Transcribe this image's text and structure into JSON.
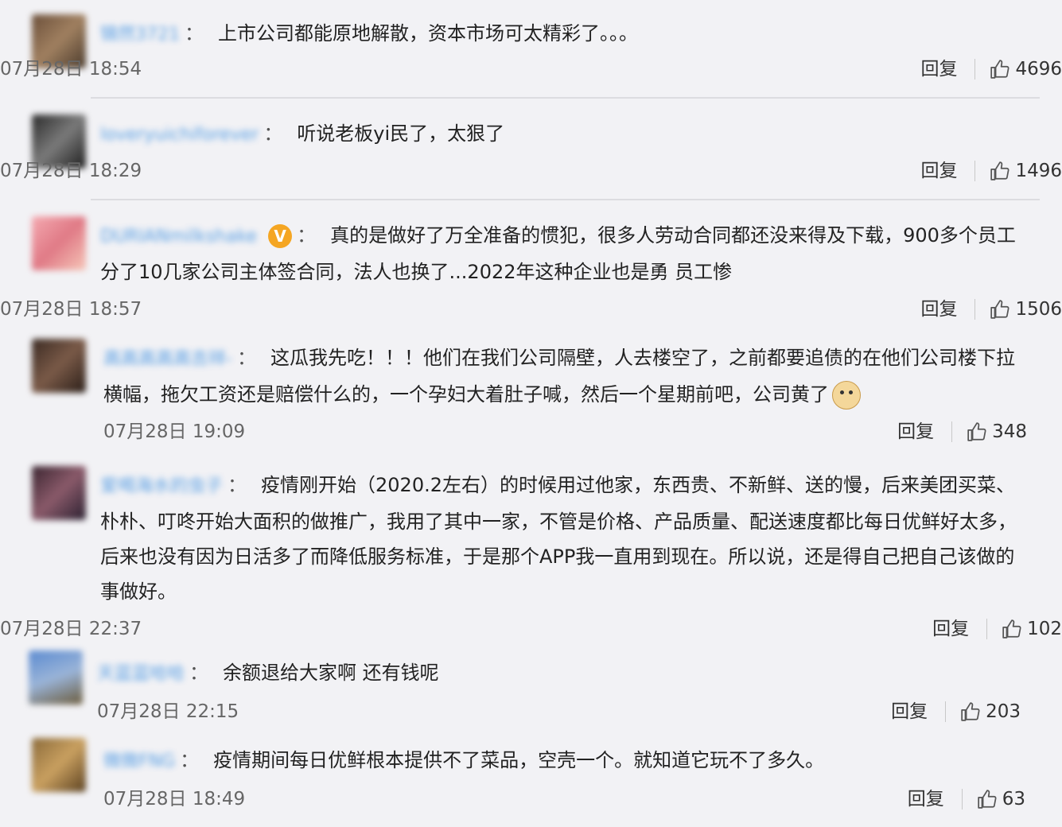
{
  "colors": {
    "panel_bg": "#f2f2f5",
    "username": "#3c8fe0",
    "time": "#666666",
    "text": "#222222",
    "badge": "#f5a623"
  },
  "comments": [
    {
      "username": "锦然3721",
      "text": "上市公司都能原地解散，资本市场可太精彩了。。。",
      "time": "07月28日 18:54",
      "reply_label": "回复",
      "likes": "4696",
      "verified": false
    },
    {
      "username": "loveryuichiforever",
      "text": "听说老板yi民了，太狠了",
      "time": "07月28日 18:29",
      "reply_label": "回复",
      "likes": "1496",
      "verified": false
    },
    {
      "username": "DURIANmilkshake",
      "text": "真的是做好了万全准备的惯犯，很多人劳动合同都还没来得及下载，900多个员工分了10几家公司主体签合同，法人也换了...2022年这种企业也是勇 员工惨",
      "time": "07月28日 18:57",
      "reply_label": "回复",
      "likes": "1506",
      "verified": true,
      "verified_glyph": "V"
    },
    {
      "username": "高高高高高吉祥-",
      "text": "这瓜我先吃！！！他们在我们公司隔壁，人去楼空了，之前都要追债的在他们公司楼下拉横幅，拖欠工资还是赔偿什么的，一个孕妇大着肚子喊，然后一个星期前吧，公司黄了",
      "time": "07月28日 19:09",
      "reply_label": "回复",
      "likes": "348",
      "verified": false,
      "emoji": "doge-emoji"
    },
    {
      "username": "爱喝海水的虫子",
      "text": "疫情刚开始（2020.2左右）的时候用过他家，东西贵、不新鲜、送的慢，后来美团买菜、朴朴、叮咚开始大面积的做推广，我用了其中一家，不管是价格、产品质量、配送速度都比每日优鲜好太多，后来也没有因为日活多了而降低服务标准，于是那个APP我一直用到现在。所以说，还是得自己把自己该做的事做好。",
      "time": "07月28日 22:37",
      "reply_label": "回复",
      "likes": "102",
      "verified": false
    },
    {
      "username": "天蓝蓝哈哈",
      "text": "余额退给大家啊 还有钱呢",
      "time": "07月28日 22:15",
      "reply_label": "回复",
      "likes": "203",
      "verified": false
    },
    {
      "username": "微微FNG",
      "text": "疫情期间每日优鲜根本提供不了菜品，空壳一个。就知道它玩不了多久。",
      "time": "07月28日 18:49",
      "reply_label": "回复",
      "likes": "63",
      "verified": false
    }
  ]
}
